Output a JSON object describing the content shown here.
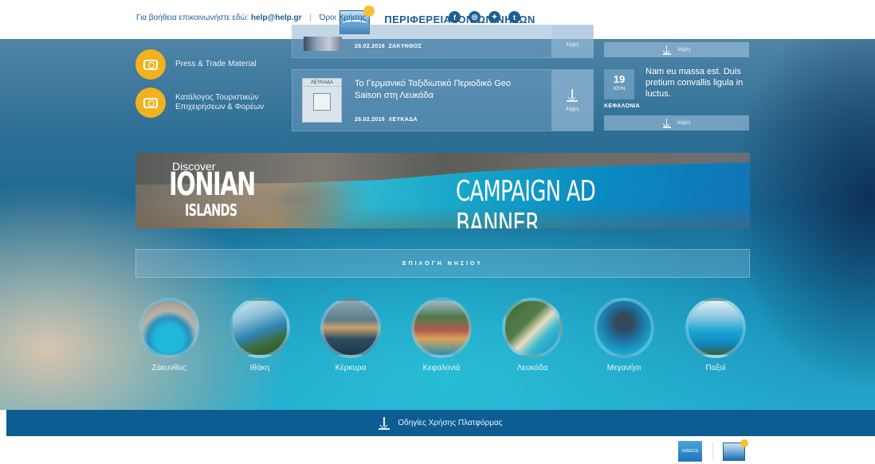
{
  "header": {
    "title": "ΠΕΡΙΦΕΡΕΙΑ ΙΟΝΙΩΝ ΝΗΣΩΝ"
  },
  "left_links": [
    {
      "label": "Press & Trade Material"
    },
    {
      "label": "Κατάλογος Τουριστικών Επιχειρήσεων & Φορέων"
    }
  ],
  "news": [
    {
      "date": "26.02.2016",
      "place": "ΖΑΚΥΝΘΟΣ",
      "download": "λήψη"
    },
    {
      "thumb_label": "ΛΕΥΚΑΔΑ",
      "title": "Το Γερμανικό Ταξιδιωτικό Περιοδικό Geo Saison στη Λευκάδα",
      "date": "26.02.2016",
      "place": "ΛΕΥΚΑΔΑ",
      "download": "λήψη"
    }
  ],
  "right": {
    "download_label_top": "λήψη",
    "event": {
      "day": "19",
      "month": "ΙΟΥΝ",
      "text": "Nam eu massa est. Duis pretium convallis ligula in luctus.",
      "place": "ΚΕΦΑΛΟΝΙΑ"
    },
    "download_label_bottom": "λήψη"
  },
  "banner": {
    "discover": "Discover",
    "ionian": "IONIAN",
    "islands": "ISLANDS",
    "text": "CAMPAIGN AD BANNER"
  },
  "island_select": {
    "title": "ΕΠΙΛΟΓΗ ΝΗΣΙΟΥ"
  },
  "islands": [
    {
      "name": "Ζάκυνθος"
    },
    {
      "name": "Ιθάκη"
    },
    {
      "name": "Κέρκυρα"
    },
    {
      "name": "Κεφαλονιά"
    },
    {
      "name": "Λευκάδα"
    },
    {
      "name": "Μεγανήσι"
    },
    {
      "name": "Παξοί"
    }
  ],
  "guide_bar": {
    "label": "Οδηγίες Χρήσης Πλατφόρμας"
  },
  "footer": {
    "help_text": "Για βοήθεια επικοινωνήστε εδώ:",
    "help_email": "help@help.gr",
    "separator": "|",
    "terms": "Όροι Χρήσης",
    "greece_badge": "GREECE"
  },
  "social": [
    {
      "icon": "facebook-icon",
      "glyph": "f"
    },
    {
      "icon": "instagram-icon",
      "glyph": "◎"
    },
    {
      "icon": "twitter-icon",
      "glyph": "✦"
    },
    {
      "icon": "tumblr-icon",
      "glyph": "t"
    }
  ],
  "colors": {
    "accent": "#f2b21d",
    "brand_blue": "#1d5f98",
    "guide_bar": "#0d5d93"
  }
}
